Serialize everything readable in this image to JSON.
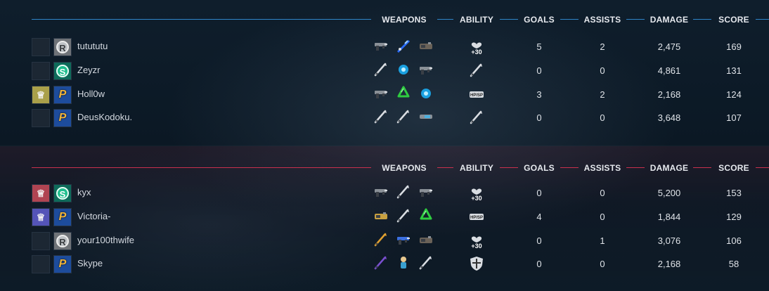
{
  "columns": {
    "weapons": "WEAPONS",
    "ability": "ABILITY",
    "goals": "GOALS",
    "assists": "ASSISTS",
    "damage": "DAMAGE",
    "score": "SCORE"
  },
  "colors": {
    "blue_team_line": "#2f86c9",
    "red_team_line": "#c9304e"
  },
  "teams": [
    {
      "side": "blue",
      "players": [
        {
          "name": "tutututu",
          "emblem": "none",
          "rank": "rank-r",
          "weapons": [
            "shotgun-icon",
            "blue-rifle-icon",
            "launcher-icon"
          ],
          "ability": "heal-plus30-icon",
          "goals": "5",
          "assists": "2",
          "damage": "2,475",
          "score": "169"
        },
        {
          "name": "Zeyzr",
          "emblem": "none",
          "rank": "rank-s",
          "weapons": [
            "scythe-icon",
            "blue-drone-icon",
            "pistol-icon"
          ],
          "ability": "dash-blade-icon",
          "goals": "0",
          "assists": "0",
          "damage": "4,861",
          "score": "131"
        },
        {
          "name": "Holl0w",
          "emblem": "emblem-gold",
          "rank": "rank-p",
          "weapons": [
            "smg-icon",
            "green-recycle-icon",
            "blue-orb-icon"
          ],
          "ability": "hp-sp-icon",
          "goals": "3",
          "assists": "2",
          "damage": "2,168",
          "score": "124"
        },
        {
          "name": "DeusKodoku.",
          "emblem": "none",
          "rank": "rank-p",
          "weapons": [
            "blade-icon",
            "sword-icon",
            "railgun-icon"
          ],
          "ability": "dash-blade-icon",
          "goals": "0",
          "assists": "0",
          "damage": "3,648",
          "score": "107"
        }
      ]
    },
    {
      "side": "red",
      "players": [
        {
          "name": "kyx",
          "emblem": "emblem-red",
          "rank": "rank-s",
          "weapons": [
            "rifle-icon",
            "sword-icon",
            "pistol-icon"
          ],
          "ability": "heal-plus30-icon",
          "goals": "0",
          "assists": "0",
          "damage": "5,200",
          "score": "153"
        },
        {
          "name": "Victoria-",
          "emblem": "emblem-purple",
          "rank": "rank-p",
          "weapons": [
            "gold-launcher-icon",
            "sword-icon",
            "green-recycle-icon"
          ],
          "ability": "hp-sp-icon",
          "goals": "4",
          "assists": "0",
          "damage": "1,844",
          "score": "129"
        },
        {
          "name": "your100thwife",
          "emblem": "none",
          "rank": "rank-r",
          "weapons": [
            "gold-blade-icon",
            "blue-smg-icon",
            "launcher-icon"
          ],
          "ability": "heal-plus30-icon",
          "goals": "0",
          "assists": "1",
          "damage": "3,076",
          "score": "106"
        },
        {
          "name": "Skype",
          "emblem": "none",
          "rank": "rank-p",
          "weapons": [
            "purple-staff-icon",
            "drone-figure-icon",
            "crossbow-icon"
          ],
          "ability": "shield-icon",
          "goals": "0",
          "assists": "0",
          "damage": "2,168",
          "score": "58"
        }
      ]
    }
  ]
}
